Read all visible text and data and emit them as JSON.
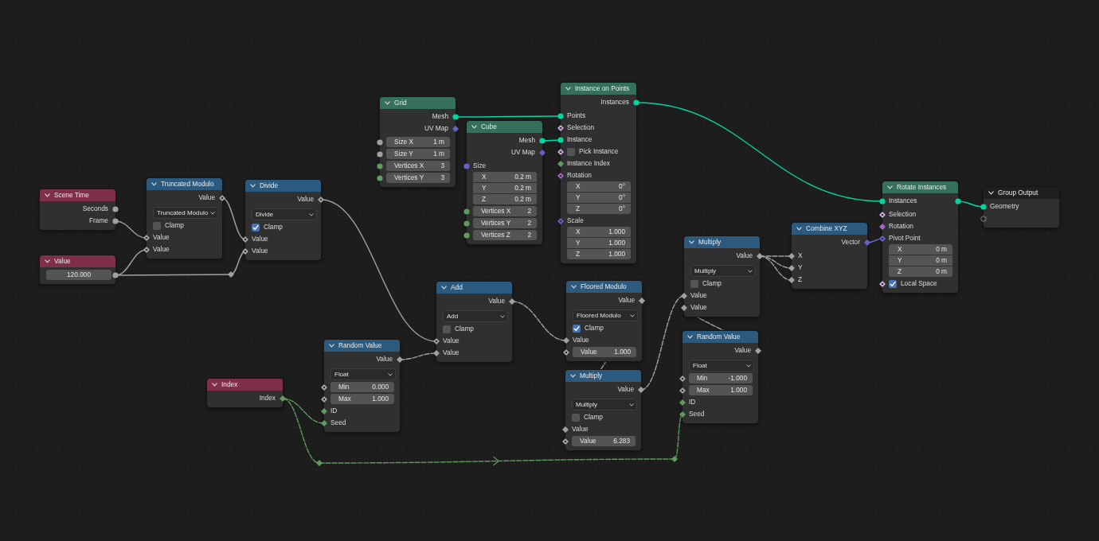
{
  "nodes": [
    {
      "title": "Scene Time",
      "kind": "input",
      "rows": [
        {
          "kind": "output",
          "label": "Seconds",
          "socket": {
            "kind": "circle",
            "color": "#a1a1a1"
          }
        },
        {
          "kind": "output",
          "label": "Frame",
          "socket": {
            "kind": "circle",
            "color": "#a1a1a1"
          }
        }
      ]
    },
    {
      "title": "Value",
      "kind": "input",
      "rows": [
        {
          "kind": "value_output",
          "value": "120.000",
          "socket": {
            "kind": "circle",
            "color": "#a1a1a1"
          }
        }
      ]
    },
    {
      "title": "Truncated Modulo",
      "kind": "converter",
      "rows": [
        {
          "kind": "output",
          "label": "Value",
          "socket": {
            "kind": "diamond_dot",
            "color": "#a1a1a1"
          }
        },
        {
          "kind": "dropdown",
          "value": "Truncated Modulo"
        },
        {
          "kind": "checkbox",
          "label": "Clamp",
          "checked": false
        },
        {
          "kind": "input",
          "label": "Value",
          "socket": {
            "kind": "diamond_dot",
            "color": "#a1a1a1"
          }
        },
        {
          "kind": "input",
          "label": "Value",
          "socket": {
            "kind": "diamond_dot",
            "color": "#a1a1a1"
          }
        }
      ]
    },
    {
      "title": "Divide",
      "kind": "converter",
      "rows": [
        {
          "kind": "output",
          "label": "Value",
          "socket": {
            "kind": "diamond_dot",
            "color": "#a1a1a1"
          }
        },
        {
          "kind": "dropdown",
          "value": "Divide"
        },
        {
          "kind": "checkbox",
          "label": "Clamp",
          "checked": true
        },
        {
          "kind": "input",
          "label": "Value",
          "socket": {
            "kind": "diamond_dot",
            "color": "#a1a1a1"
          }
        },
        {
          "kind": "input",
          "label": "Value",
          "socket": {
            "kind": "diamond_dot",
            "color": "#a1a1a1"
          }
        }
      ]
    },
    {
      "title": "Index",
      "kind": "input",
      "rows": [
        {
          "kind": "output",
          "label": "Index",
          "socket": {
            "kind": "diamond",
            "color": "#5f9a5f"
          }
        }
      ]
    },
    {
      "title": "Random Value",
      "kind": "converter",
      "rows": [
        {
          "kind": "output",
          "label": "Value",
          "socket": {
            "kind": "diamond",
            "color": "#a1a1a1"
          }
        },
        {
          "kind": "dropdown",
          "value": "Float"
        },
        {
          "kind": "field",
          "label": "Min",
          "value": "0.000",
          "socket": {
            "kind": "diamond_dot",
            "color": "#a1a1a1"
          }
        },
        {
          "kind": "field",
          "label": "Max",
          "value": "1.000",
          "socket": {
            "kind": "diamond_dot",
            "color": "#a1a1a1"
          }
        },
        {
          "kind": "input",
          "label": "ID",
          "socket": {
            "kind": "diamond",
            "color": "#5f9a5f"
          }
        },
        {
          "kind": "input",
          "label": "Seed",
          "socket": {
            "kind": "diamond",
            "color": "#5f9a5f"
          }
        }
      ]
    },
    {
      "title": "Add",
      "kind": "converter",
      "rows": [
        {
          "kind": "output",
          "label": "Value",
          "socket": {
            "kind": "diamond",
            "color": "#a1a1a1"
          }
        },
        {
          "kind": "dropdown",
          "value": "Add"
        },
        {
          "kind": "checkbox",
          "label": "Clamp",
          "checked": false
        },
        {
          "kind": "input",
          "label": "Value",
          "socket": {
            "kind": "diamond_dot",
            "color": "#a1a1a1"
          }
        },
        {
          "kind": "input",
          "label": "Value",
          "socket": {
            "kind": "diamond",
            "color": "#a1a1a1"
          }
        }
      ]
    },
    {
      "title": "Grid",
      "kind": "geometry",
      "rows": [
        {
          "kind": "output",
          "label": "Mesh",
          "socket": {
            "kind": "circle",
            "color": "#00d6a3"
          }
        },
        {
          "kind": "output",
          "label": "UV Map",
          "socket": {
            "kind": "diamond",
            "color": "#6363c7"
          }
        },
        {
          "kind": "field",
          "label": "Size X",
          "value": "1 m",
          "socket": {
            "kind": "circle",
            "color": "#a1a1a1"
          }
        },
        {
          "kind": "field",
          "label": "Size Y",
          "value": "1 m",
          "socket": {
            "kind": "circle",
            "color": "#a1a1a1"
          }
        },
        {
          "kind": "field",
          "label": "Vertices X",
          "value": "3",
          "socket": {
            "kind": "circle",
            "color": "#5f9a5f"
          }
        },
        {
          "kind": "field",
          "label": "Vertices Y",
          "value": "3",
          "socket": {
            "kind": "circle",
            "color": "#5f9a5f"
          }
        }
      ]
    },
    {
      "title": "Cube",
      "kind": "geometry",
      "rows": [
        {
          "kind": "output",
          "label": "Mesh",
          "socket": {
            "kind": "circle",
            "color": "#00d6a3"
          }
        },
        {
          "kind": "output",
          "label": "UV Map",
          "socket": {
            "kind": "diamond",
            "color": "#6363c7"
          }
        },
        {
          "kind": "input",
          "label": "Size",
          "socket": {
            "kind": "circle",
            "color": "#6363c7"
          }
        },
        {
          "kind": "vector",
          "components": [
            {
              "label": "X",
              "value": "0.2 m"
            },
            {
              "label": "Y",
              "value": "0.2 m"
            },
            {
              "label": "Z",
              "value": "0.2 m"
            }
          ]
        },
        {
          "kind": "field",
          "label": "Vertices X",
          "value": "2",
          "socket": {
            "kind": "circle",
            "color": "#5f9a5f"
          }
        },
        {
          "kind": "field",
          "label": "Vertices Y",
          "value": "2",
          "socket": {
            "kind": "circle",
            "color": "#5f9a5f"
          }
        },
        {
          "kind": "field",
          "label": "Vertices Z",
          "value": "2",
          "socket": {
            "kind": "circle",
            "color": "#5f9a5f"
          }
        }
      ]
    },
    {
      "title": "Instance on Points",
      "kind": "geometry",
      "rows": [
        {
          "kind": "output",
          "label": "Instances",
          "socket": {
            "kind": "circle",
            "color": "#00d6a3"
          }
        },
        {
          "kind": "input",
          "label": "Points",
          "socket": {
            "kind": "circle",
            "color": "#00d6a3"
          }
        },
        {
          "kind": "input",
          "label": "Selection",
          "socket": {
            "kind": "diamond_dot",
            "color": "#cca6d6"
          }
        },
        {
          "kind": "input",
          "label": "Instance",
          "socket": {
            "kind": "circle",
            "color": "#00d6a3"
          }
        },
        {
          "kind": "checkbox",
          "label": "Pick Instance",
          "checked": false,
          "socket": {
            "kind": "diamond_dot",
            "color": "#cca6d6"
          }
        },
        {
          "kind": "input",
          "label": "Instance Index",
          "socket": {
            "kind": "diamond",
            "color": "#5f9a5f"
          }
        },
        {
          "kind": "input",
          "label": "Rotation",
          "socket": {
            "kind": "diamond_dot",
            "color": "#a663c7"
          }
        },
        {
          "kind": "vector",
          "components": [
            {
              "label": "X",
              "value": "0°"
            },
            {
              "label": "Y",
              "value": "0°"
            },
            {
              "label": "Z",
              "value": "0°"
            }
          ]
        },
        {
          "kind": "input",
          "label": "Scale",
          "socket": {
            "kind": "diamond_dot",
            "color": "#6363c7"
          }
        },
        {
          "kind": "vector",
          "components": [
            {
              "label": "X",
              "value": "1.000"
            },
            {
              "label": "Y",
              "value": "1.000"
            },
            {
              "label": "Z",
              "value": "1.000"
            }
          ]
        }
      ]
    },
    {
      "title": "Floored Modulo",
      "kind": "converter",
      "rows": [
        {
          "kind": "output",
          "label": "Value",
          "socket": {
            "kind": "diamond",
            "color": "#a1a1a1"
          }
        },
        {
          "kind": "dropdown",
          "value": "Floored Modulo"
        },
        {
          "kind": "checkbox",
          "label": "Clamp",
          "checked": true
        },
        {
          "kind": "input",
          "label": "Value",
          "socket": {
            "kind": "diamond",
            "color": "#a1a1a1"
          }
        },
        {
          "kind": "field",
          "label": "Value",
          "value": "1.000",
          "socket": {
            "kind": "diamond_dot",
            "color": "#a1a1a1"
          }
        }
      ]
    },
    {
      "title": "Multiply",
      "kind": "converter",
      "rows": [
        {
          "kind": "output",
          "label": "Value",
          "socket": {
            "kind": "diamond",
            "color": "#a1a1a1"
          }
        },
        {
          "kind": "dropdown",
          "value": "Multiply"
        },
        {
          "kind": "checkbox",
          "label": "Clamp",
          "checked": false
        },
        {
          "kind": "input",
          "label": "Value",
          "socket": {
            "kind": "diamond",
            "color": "#a1a1a1"
          }
        },
        {
          "kind": "field",
          "label": "Value",
          "value": "6.283",
          "socket": {
            "kind": "diamond_dot",
            "color": "#a1a1a1"
          }
        }
      ]
    },
    {
      "title": "Multiply",
      "kind": "converter",
      "rows": [
        {
          "kind": "output",
          "label": "Value",
          "socket": {
            "kind": "diamond",
            "color": "#a1a1a1"
          }
        },
        {
          "kind": "dropdown",
          "value": "Multiply"
        },
        {
          "kind": "checkbox",
          "label": "Clamp",
          "checked": false
        },
        {
          "kind": "input",
          "label": "Value",
          "socket": {
            "kind": "diamond",
            "color": "#a1a1a1"
          }
        },
        {
          "kind": "input",
          "label": "Value",
          "socket": {
            "kind": "diamond",
            "color": "#a1a1a1"
          }
        }
      ]
    },
    {
      "title": "Random Value",
      "kind": "converter",
      "rows": [
        {
          "kind": "output",
          "label": "Value",
          "socket": {
            "kind": "diamond",
            "color": "#a1a1a1"
          }
        },
        {
          "kind": "dropdown",
          "value": "Float"
        },
        {
          "kind": "field",
          "label": "Min",
          "value": "-1.000",
          "socket": {
            "kind": "diamond_dot",
            "color": "#a1a1a1"
          }
        },
        {
          "kind": "field",
          "label": "Max",
          "value": "1.000",
          "socket": {
            "kind": "diamond_dot",
            "color": "#a1a1a1"
          }
        },
        {
          "kind": "input",
          "label": "ID",
          "socket": {
            "kind": "diamond",
            "color": "#5f9a5f"
          }
        },
        {
          "kind": "input",
          "label": "Seed",
          "socket": {
            "kind": "diamond",
            "color": "#5f9a5f"
          }
        }
      ]
    },
    {
      "title": "Combine XYZ",
      "kind": "converter",
      "rows": [
        {
          "kind": "output",
          "label": "Vector",
          "socket": {
            "kind": "diamond",
            "color": "#6363c7"
          }
        },
        {
          "kind": "input",
          "label": "X",
          "socket": {
            "kind": "diamond",
            "color": "#a1a1a1"
          }
        },
        {
          "kind": "input",
          "label": "Y",
          "socket": {
            "kind": "diamond",
            "color": "#a1a1a1"
          }
        },
        {
          "kind": "input",
          "label": "Z",
          "socket": {
            "kind": "diamond",
            "color": "#a1a1a1"
          }
        }
      ]
    },
    {
      "title": "Rotate Instances",
      "kind": "geometry",
      "rows": [
        {
          "kind": "through",
          "label": "Instances",
          "socket": {
            "kind": "circle",
            "color": "#00d6a3"
          }
        },
        {
          "kind": "input",
          "label": "Selection",
          "socket": {
            "kind": "diamond_dot",
            "color": "#cca6d6"
          }
        },
        {
          "kind": "input",
          "label": "Rotation",
          "socket": {
            "kind": "diamond",
            "color": "#a663c7"
          }
        },
        {
          "kind": "input",
          "label": "Pivot Point",
          "socket": {
            "kind": "diamond_dot",
            "color": "#6363c7"
          }
        },
        {
          "kind": "vector",
          "components": [
            {
              "label": "X",
              "value": "0 m"
            },
            {
              "label": "Y",
              "value": "0 m"
            },
            {
              "label": "Z",
              "value": "0 m"
            }
          ]
        },
        {
          "kind": "checkbox",
          "label": "Local Space",
          "checked": true,
          "socket": {
            "kind": "diamond_dot",
            "color": "#cca6d6"
          }
        }
      ]
    },
    {
      "title": "Group Output",
      "kind": "output",
      "rows": [
        {
          "kind": "input",
          "label": "Geometry",
          "socket": {
            "kind": "circle",
            "color": "#00d6a3"
          }
        },
        {
          "kind": "empty_input"
        }
      ]
    }
  ]
}
